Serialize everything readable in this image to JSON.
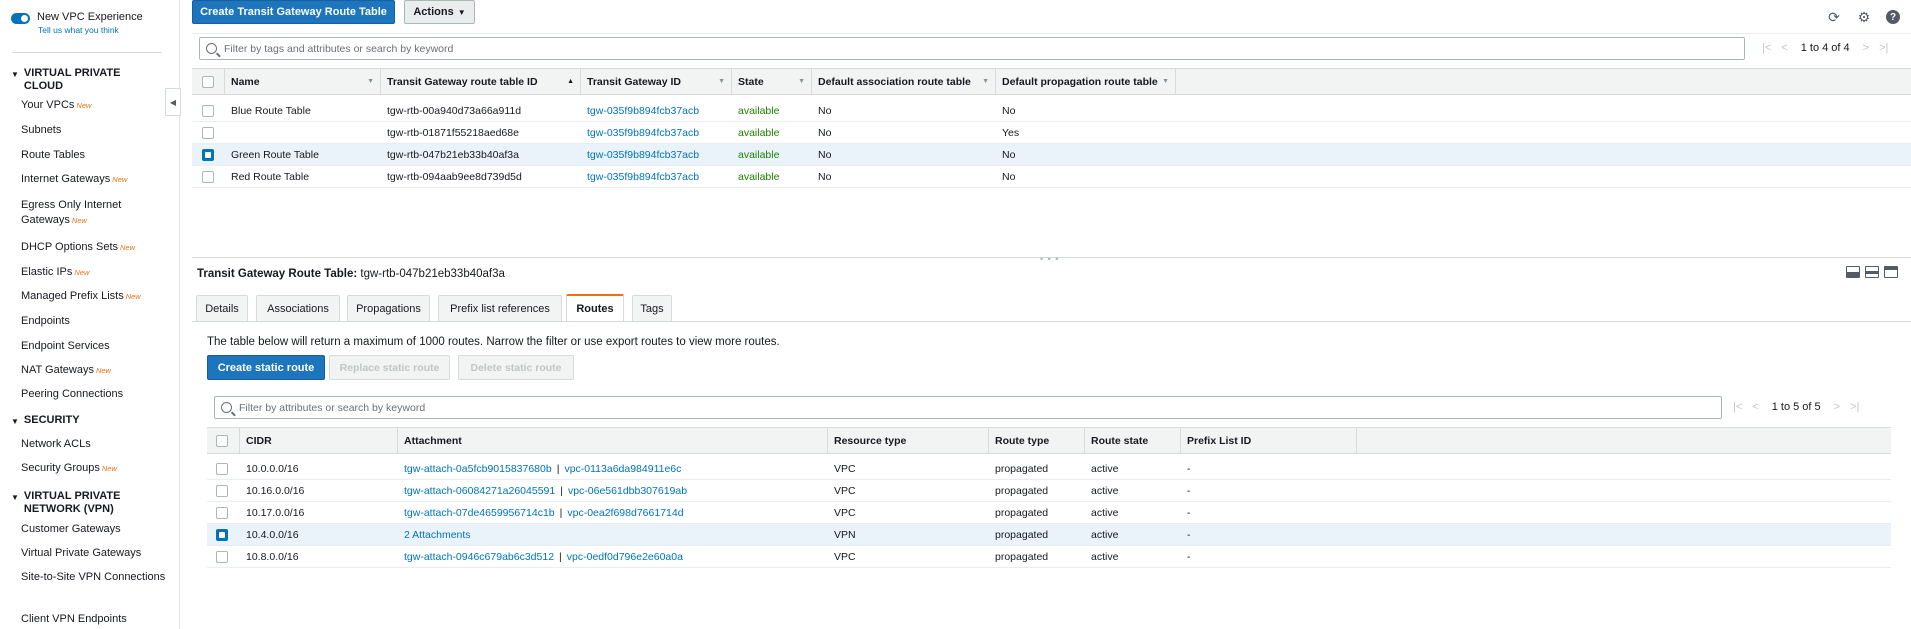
{
  "sidebar": {
    "vpc_experience_title": "New VPC Experience",
    "vpc_experience_link": "Tell us what you think",
    "new_badge": "New",
    "sections": [
      {
        "title": "VIRTUAL PRIVATE CLOUD"
      },
      {
        "title": "SECURITY"
      },
      {
        "title": "VIRTUAL PRIVATE NETWORK (VPN)"
      }
    ],
    "items": [
      {
        "label": "Your VPCs",
        "new": true
      },
      {
        "label": "Subnets",
        "new": false
      },
      {
        "label": "Route Tables",
        "new": false
      },
      {
        "label": "Internet Gateways",
        "new": true
      },
      {
        "label": "Egress Only Internet Gateways",
        "new": true
      },
      {
        "label": "DHCP Options Sets",
        "new": true
      },
      {
        "label": "Elastic IPs",
        "new": true
      },
      {
        "label": "Managed Prefix Lists",
        "new": true
      },
      {
        "label": "Endpoints",
        "new": false
      },
      {
        "label": "Endpoint Services",
        "new": false
      },
      {
        "label": "NAT Gateways",
        "new": true
      },
      {
        "label": "Peering Connections",
        "new": false
      },
      {
        "label": "Network ACLs",
        "new": false
      },
      {
        "label": "Security Groups",
        "new": true
      },
      {
        "label": "Customer Gateways",
        "new": false
      },
      {
        "label": "Virtual Private Gateways",
        "new": false
      },
      {
        "label": "Site-to-Site VPN Connections",
        "new": false
      },
      {
        "label": "Client VPN Endpoints",
        "new": false
      }
    ]
  },
  "toolbar": {
    "create_label": "Create Transit Gateway Route Table",
    "actions_label": "Actions"
  },
  "top_table": {
    "search_placeholder": "Filter by tags and attributes or search by keyword",
    "pager_text": "1 to 4 of 4",
    "columns": [
      "Name",
      "Transit Gateway route table ID",
      "Transit Gateway ID",
      "State",
      "Default association route table",
      "Default propagation route table"
    ],
    "rows": [
      {
        "name": "Blue Route Table",
        "rtb_id": "tgw-rtb-00a940d73a66a911d",
        "tgw_id": "tgw-035f9b894fcb37acb",
        "state": "available",
        "assoc": "No",
        "prop": "No",
        "selected": false
      },
      {
        "name": "",
        "rtb_id": "tgw-rtb-01871f55218aed68e",
        "tgw_id": "tgw-035f9b894fcb37acb",
        "state": "available",
        "assoc": "No",
        "prop": "Yes",
        "selected": false
      },
      {
        "name": "Green Route Table",
        "rtb_id": "tgw-rtb-047b21eb33b40af3a",
        "tgw_id": "tgw-035f9b894fcb37acb",
        "state": "available",
        "assoc": "No",
        "prop": "No",
        "selected": true
      },
      {
        "name": "Red Route Table",
        "rtb_id": "tgw-rtb-094aab9ee8d739d5d",
        "tgw_id": "tgw-035f9b894fcb37acb",
        "state": "available",
        "assoc": "No",
        "prop": "No",
        "selected": false
      }
    ]
  },
  "detail": {
    "title_label": "Transit Gateway Route Table:",
    "title_value": "tgw-rtb-047b21eb33b40af3a",
    "tabs": [
      "Details",
      "Associations",
      "Propagations",
      "Prefix list references",
      "Routes",
      "Tags"
    ],
    "active_tab": "Routes",
    "info_text": "The table below will return a maximum of 1000 routes. Narrow the filter or use export routes to view more routes.",
    "create_static_label": "Create static route",
    "replace_static_label": "Replace static route",
    "delete_static_label": "Delete static route",
    "search_placeholder": "Filter by attributes or search by keyword",
    "pager_text": "1 to 5 of 5",
    "columns": [
      "CIDR",
      "Attachment",
      "Resource type",
      "Route type",
      "Route state",
      "Prefix List ID"
    ],
    "routes": [
      {
        "cidr": "10.0.0.0/16",
        "attach": "tgw-attach-0a5fcb9015837680b",
        "vpc": "vpc-0113a6da984911e6c",
        "resource": "VPC",
        "type": "propagated",
        "state": "active",
        "prefix": "-",
        "selected": false
      },
      {
        "cidr": "10.16.0.0/16",
        "attach": "tgw-attach-06084271a26045591",
        "vpc": "vpc-06e561dbb307619ab",
        "resource": "VPC",
        "type": "propagated",
        "state": "active",
        "prefix": "-",
        "selected": false
      },
      {
        "cidr": "10.17.0.0/16",
        "attach": "tgw-attach-07de4659956714c1b",
        "vpc": "vpc-0ea2f698d7661714d",
        "resource": "VPC",
        "type": "propagated",
        "state": "active",
        "prefix": "-",
        "selected": false
      },
      {
        "cidr": "10.4.0.0/16",
        "attach": "2 Attachments",
        "vpc": "",
        "resource": "VPN",
        "type": "propagated",
        "state": "active",
        "prefix": "-",
        "selected": true
      },
      {
        "cidr": "10.8.0.0/16",
        "attach": "tgw-attach-0946c679ab6c3d512",
        "vpc": "vpc-0edf0d796e2e60a0a",
        "resource": "VPC",
        "type": "propagated",
        "state": "active",
        "prefix": "-",
        "selected": false
      }
    ]
  }
}
